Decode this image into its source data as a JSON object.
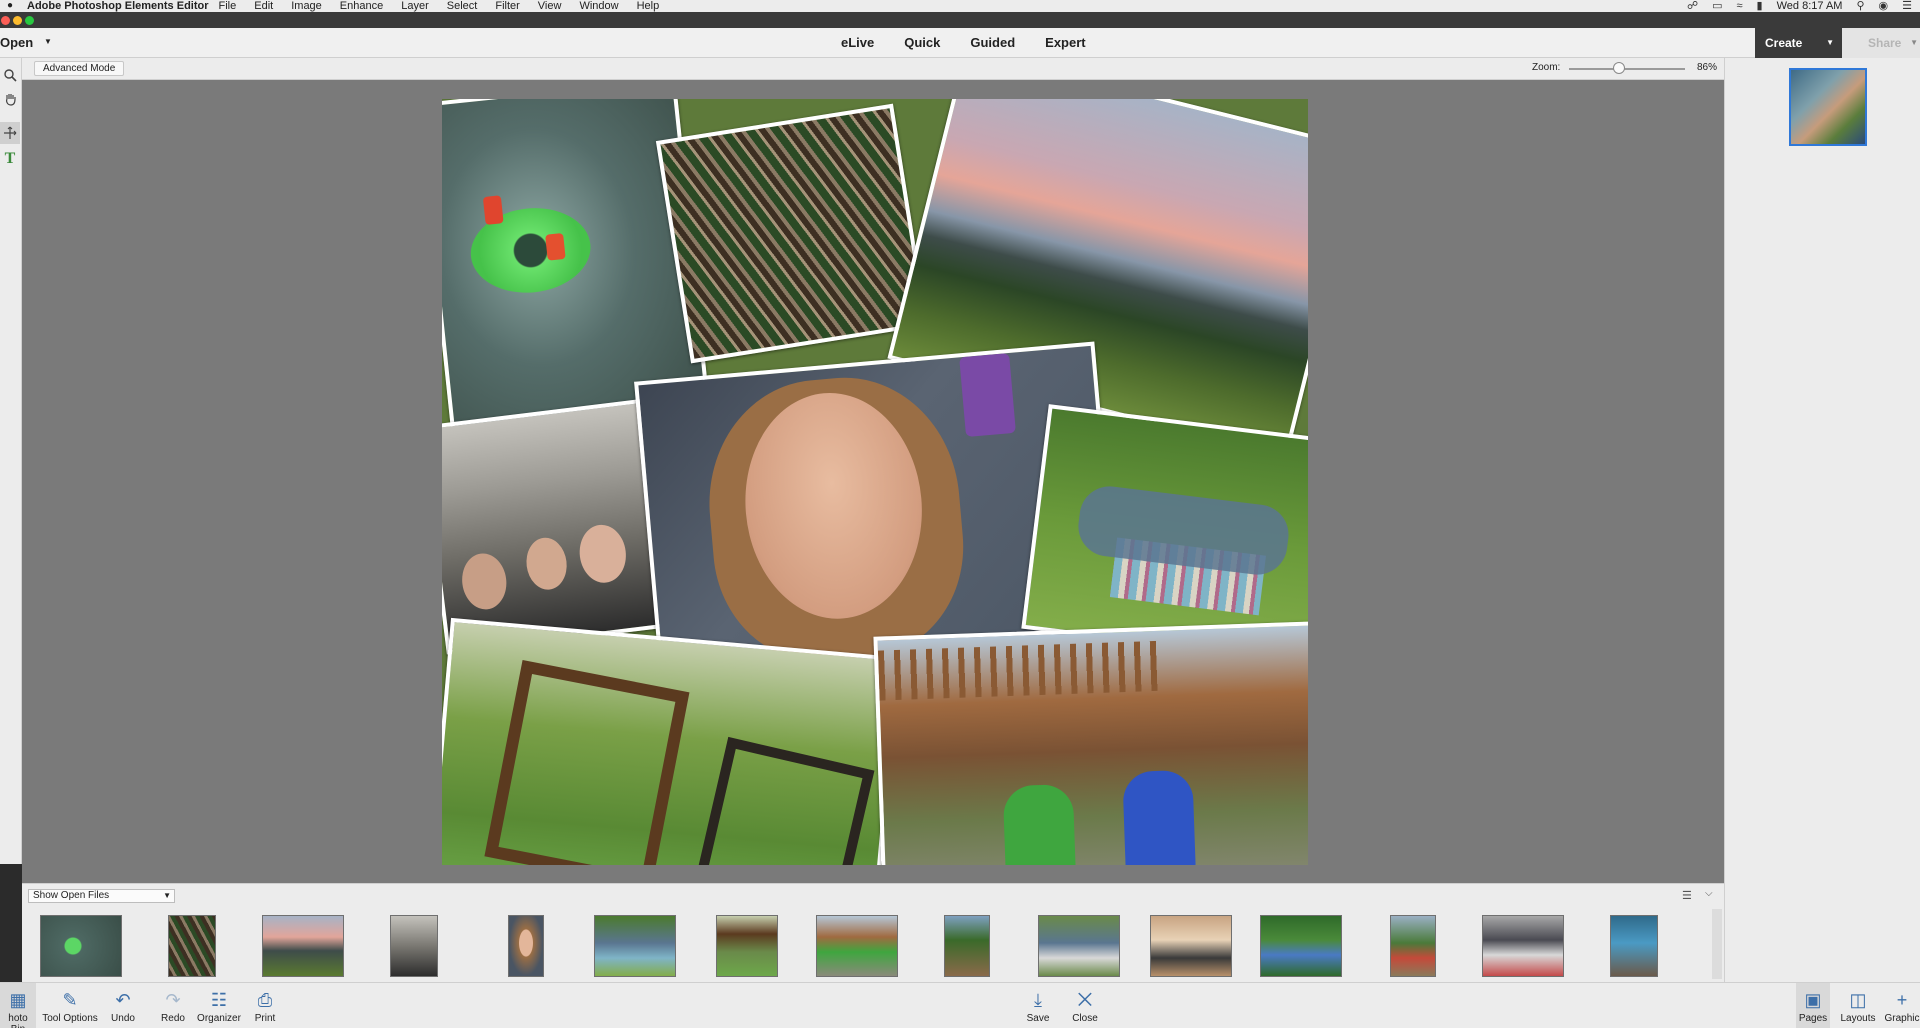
{
  "menubar": {
    "app_name": "Adobe Photoshop Elements Editor",
    "items": [
      "File",
      "Edit",
      "Image",
      "Enhance",
      "Layer",
      "Select",
      "Filter",
      "View",
      "Window",
      "Help"
    ],
    "clock": "Wed 8:17 AM"
  },
  "modebar": {
    "open_label": "Open",
    "tabs": [
      "eLive",
      "Quick",
      "Guided",
      "Expert"
    ],
    "create_label": "Create",
    "share_label": "Share"
  },
  "options": {
    "mode_button": "Advanced Mode",
    "zoom_label": "Zoom:",
    "zoom_value": "86%",
    "zoom_fraction": 0.43
  },
  "bin": {
    "show_label": "Show Open Files"
  },
  "taskbar": {
    "photo_bin": "hoto Bin",
    "tool_options": "Tool Options",
    "undo": "Undo",
    "redo": "Redo",
    "organizer": "Organizer",
    "print": "Print",
    "save": "Save",
    "close": "Close",
    "pages": "Pages",
    "layouts": "Layouts",
    "graphics": "Graphic"
  },
  "icons": {
    "zoom_tool": "zoom-icon",
    "hand_tool": "hand-icon",
    "move_tool": "move-icon",
    "type_tool": "type-icon"
  },
  "colors": {
    "accent": "#2f78d8",
    "canvas": "#7a7a7a",
    "panel": "#ececec"
  }
}
